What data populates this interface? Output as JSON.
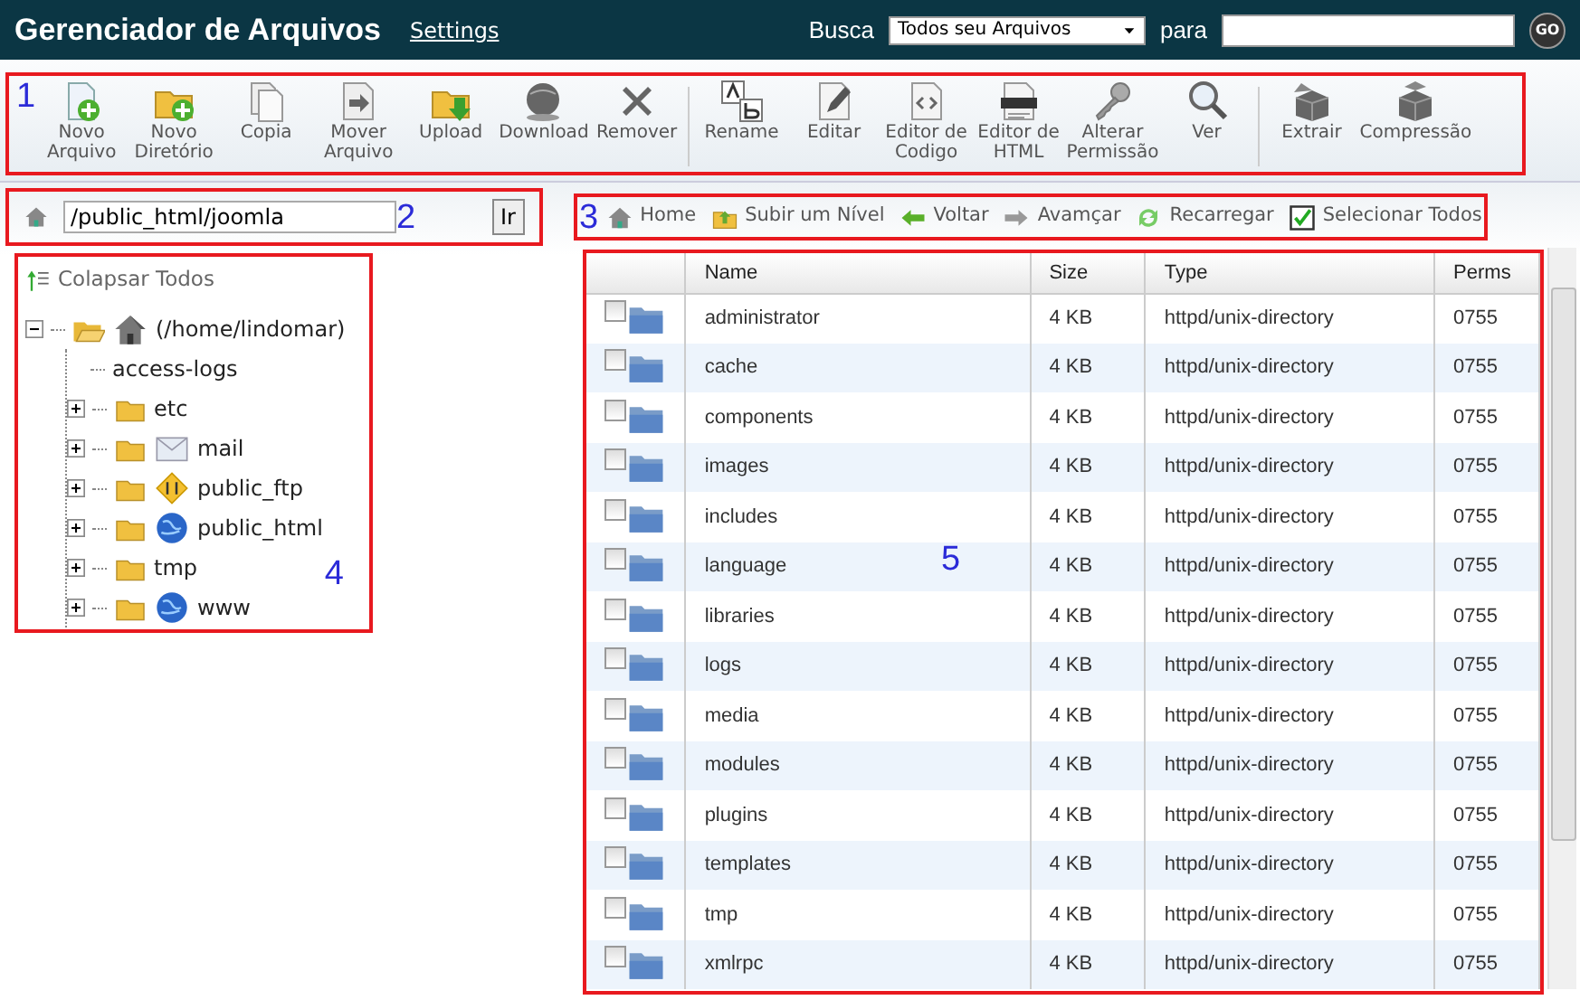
{
  "header": {
    "title": "Gerenciador de Arquivos",
    "settings_link": "Settings",
    "search": {
      "label": "Busca",
      "scope": "Todos seu Arquivos",
      "for_label": "para",
      "button": "GO"
    }
  },
  "toolbar": {
    "annotation": "1",
    "groups": [
      [
        {
          "kind": "newfile",
          "label": "Novo\nArquivo"
        },
        {
          "kind": "newfolder",
          "label": "Novo\nDiretório"
        },
        {
          "kind": "copy",
          "label": "Copia"
        },
        {
          "kind": "move",
          "label": "Mover\nArquivo"
        },
        {
          "kind": "upload",
          "label": "Upload"
        },
        {
          "kind": "download",
          "label": "Download"
        },
        {
          "kind": "delete",
          "label": "Remover"
        }
      ],
      [
        {
          "kind": "rename",
          "label": "Rename"
        },
        {
          "kind": "edit",
          "label": "Editar"
        },
        {
          "kind": "code",
          "label": "Editor de\nCodigo"
        },
        {
          "kind": "html",
          "label": "Editor de\nHTML"
        },
        {
          "kind": "key",
          "label": "Alterar\nPermissão"
        },
        {
          "kind": "view",
          "label": "Ver"
        }
      ],
      [
        {
          "kind": "extract",
          "label": "Extrair"
        },
        {
          "kind": "compress",
          "label": "Compressão"
        }
      ]
    ]
  },
  "path_bar": {
    "annotation": "2",
    "value": "/public_html/joomla",
    "button": "Ir"
  },
  "nav_bar": {
    "annotation": "3",
    "items": [
      {
        "kind": "home",
        "label": "Home"
      },
      {
        "kind": "up",
        "label": "Subir um Nível"
      },
      {
        "kind": "back",
        "label": "Voltar"
      },
      {
        "kind": "forward",
        "label": "Avamçar"
      },
      {
        "kind": "reload",
        "label": "Recarregar"
      },
      {
        "kind": "checkbox",
        "label": "Selecionar Todos",
        "checked": true
      }
    ]
  },
  "tree": {
    "annotation": "4",
    "collapse_all": "Colapsar Todos",
    "items": [
      {
        "kind": "home",
        "label": "(/home/lindomar)",
        "expanded": true,
        "children": [
          {
            "kind": "file",
            "label": "access-logs"
          },
          {
            "kind": "folder",
            "label": "etc",
            "expanded": false
          },
          {
            "kind": "mail",
            "label": "mail",
            "expanded": false
          },
          {
            "kind": "ftp",
            "label": "public_ftp",
            "expanded": false
          },
          {
            "kind": "web",
            "label": "public_html",
            "expanded": false
          },
          {
            "kind": "folder",
            "label": "tmp",
            "expanded": false
          },
          {
            "kind": "web",
            "label": "www",
            "expanded": false
          }
        ]
      }
    ]
  },
  "table": {
    "annotation": "5",
    "columns": [
      "Name",
      "Size",
      "Type",
      "Perms"
    ],
    "rows": [
      {
        "name": "administrator",
        "size": "4 KB",
        "type": "httpd/unix-directory",
        "perms": "0755",
        "checked": false
      },
      {
        "name": "cache",
        "size": "4 KB",
        "type": "httpd/unix-directory",
        "perms": "0755",
        "checked": false
      },
      {
        "name": "components",
        "size": "4 KB",
        "type": "httpd/unix-directory",
        "perms": "0755",
        "checked": false
      },
      {
        "name": "images",
        "size": "4 KB",
        "type": "httpd/unix-directory",
        "perms": "0755",
        "checked": false
      },
      {
        "name": "includes",
        "size": "4 KB",
        "type": "httpd/unix-directory",
        "perms": "0755",
        "checked": false
      },
      {
        "name": "language",
        "size": "4 KB",
        "type": "httpd/unix-directory",
        "perms": "0755",
        "checked": false
      },
      {
        "name": "libraries",
        "size": "4 KB",
        "type": "httpd/unix-directory",
        "perms": "0755",
        "checked": false
      },
      {
        "name": "logs",
        "size": "4 KB",
        "type": "httpd/unix-directory",
        "perms": "0755",
        "checked": false
      },
      {
        "name": "media",
        "size": "4 KB",
        "type": "httpd/unix-directory",
        "perms": "0755",
        "checked": false
      },
      {
        "name": "modules",
        "size": "4 KB",
        "type": "httpd/unix-directory",
        "perms": "0755",
        "checked": false
      },
      {
        "name": "plugins",
        "size": "4 KB",
        "type": "httpd/unix-directory",
        "perms": "0755",
        "checked": false
      },
      {
        "name": "templates",
        "size": "4 KB",
        "type": "httpd/unix-directory",
        "perms": "0755",
        "checked": false
      },
      {
        "name": "tmp",
        "size": "4 KB",
        "type": "httpd/unix-directory",
        "perms": "0755",
        "checked": false
      },
      {
        "name": "xmlrpc",
        "size": "4 KB",
        "type": "httpd/unix-directory",
        "perms": "0755",
        "checked": false
      }
    ]
  }
}
